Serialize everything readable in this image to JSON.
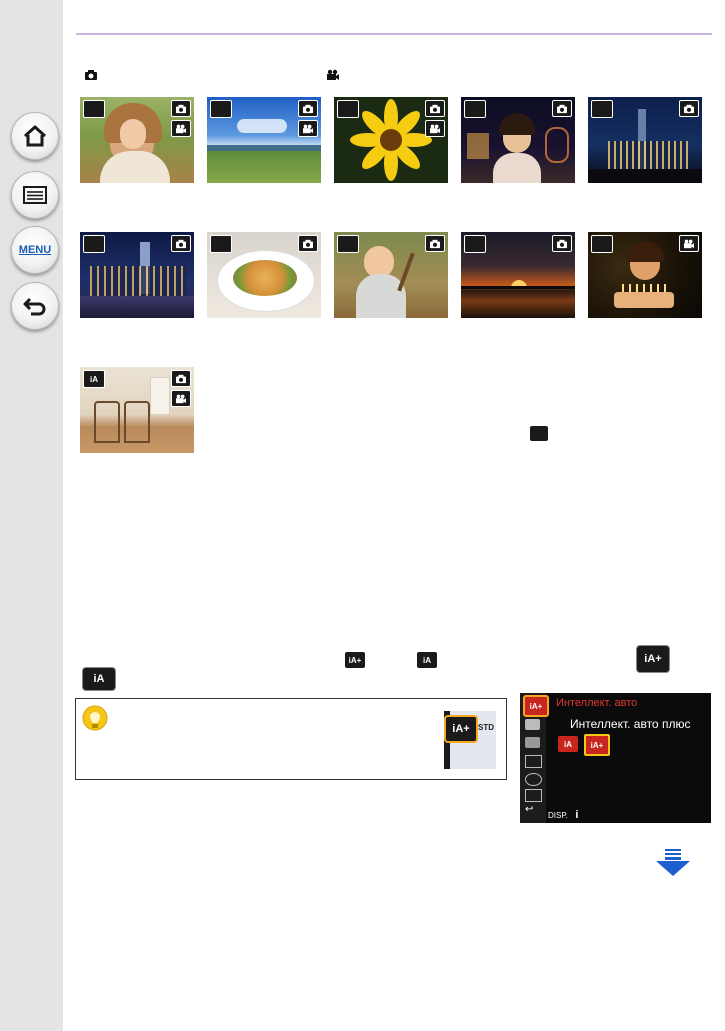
{
  "sidebar": {
    "items": [
      {
        "name": "home",
        "label": ""
      },
      {
        "name": "contents",
        "label": ""
      },
      {
        "name": "menu",
        "label": "MENU"
      },
      {
        "name": "back",
        "label": ""
      }
    ]
  },
  "scene_thumbnails": [
    {
      "scene": "portrait",
      "badge": "",
      "photo": true,
      "video": true
    },
    {
      "scene": "scenery",
      "badge": "",
      "photo": true,
      "video": true
    },
    {
      "scene": "macro",
      "badge": "",
      "photo": true,
      "video": true
    },
    {
      "scene": "night-portrait",
      "badge": "",
      "photo": true,
      "video": false
    },
    {
      "scene": "handheld-night-shot",
      "badge": "",
      "photo": true,
      "video": false
    },
    {
      "scene": "night-scenery",
      "badge": "",
      "photo": true,
      "video": false
    },
    {
      "scene": "food",
      "badge": "",
      "photo": true,
      "video": false
    },
    {
      "scene": "baby",
      "badge": "",
      "photo": true,
      "video": false
    },
    {
      "scene": "sunset",
      "badge": "",
      "photo": true,
      "video": false
    },
    {
      "scene": "low-light",
      "badge": "",
      "photo": false,
      "video": true
    },
    {
      "scene": "intelligent-auto",
      "badge": "iA",
      "photo": true,
      "video": true
    }
  ],
  "menu_screen": {
    "title": "Интеллект. авто",
    "subtitle": "Интеллект. авто плюс",
    "disp_label": "DISP.",
    "info_label": "i"
  },
  "hint_box": {
    "badge_text": "STD"
  },
  "footer": {
    "page_number": "   "
  },
  "colors": {
    "sidebar_bg": "#e4e4e4",
    "rule": "#c8b9dc",
    "accent_orange": "#f5a623",
    "menu_red": "#e0372e",
    "arrow_blue": "#1e5fd0"
  }
}
